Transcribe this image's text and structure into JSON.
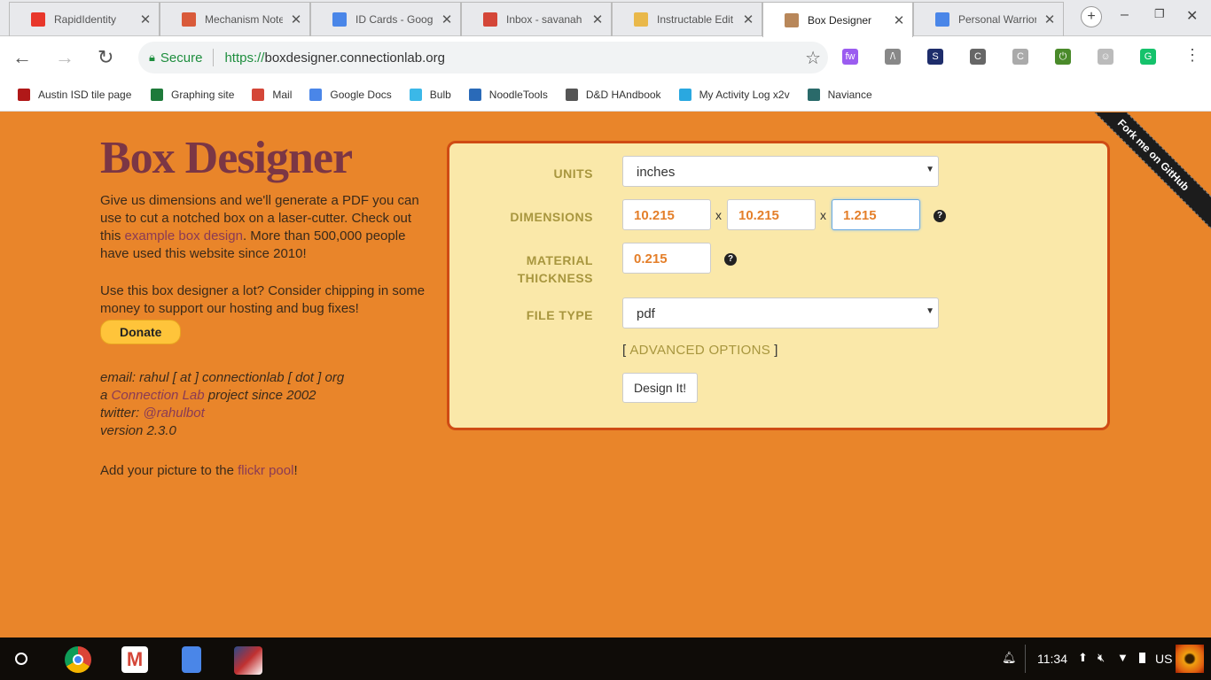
{
  "browser": {
    "tabs": [
      {
        "title": "RapidIdentity",
        "color": "#e8372b"
      },
      {
        "title": "Mechanism Note",
        "color": "#d95a3a"
      },
      {
        "title": "ID Cards - Google",
        "color": "#4a86e8"
      },
      {
        "title": "Inbox - savanah",
        "color": "#d44638"
      },
      {
        "title": "Instructable Edit",
        "color": "#e9b84a"
      },
      {
        "title": "Box Designer",
        "color": "#b8875a",
        "active": true
      },
      {
        "title": "Personal Warrior",
        "color": "#4a86e8"
      }
    ],
    "close_glyph": "✕",
    "secure_label": "Secure",
    "url_scheme": "https://",
    "url_host": "boxdesigner.connectionlab.org",
    "extensions": [
      {
        "icon": "fw-extension-icon",
        "text": "fw",
        "color": "#9b5cf0"
      },
      {
        "icon": "lambda-extension-icon",
        "text": "/\\",
        "color": "#888"
      },
      {
        "icon": "s-extension-icon",
        "text": "S",
        "color": "#1e2d6b"
      },
      {
        "icon": "c-extension-icon",
        "text": "C",
        "color": "#666"
      },
      {
        "icon": "c-gray-extension-icon",
        "text": "C",
        "color": "#aaa"
      },
      {
        "icon": "power-extension-icon",
        "text": "⏻",
        "color": "#4a8a2a"
      },
      {
        "icon": "person-extension-icon",
        "text": "☺",
        "color": "#bbb"
      },
      {
        "icon": "grammarly-icon",
        "text": "G",
        "color": "#15c26b"
      }
    ],
    "bookmarks": [
      {
        "label": "Austin ISD tile page",
        "color": "#b01818"
      },
      {
        "label": "Graphing site",
        "color": "#1e7a3a"
      },
      {
        "label": "Mail",
        "color": "#d44638"
      },
      {
        "label": "Google Docs",
        "color": "#4a86e8"
      },
      {
        "label": "Bulb",
        "color": "#3bb8e8"
      },
      {
        "label": "NoodleTools",
        "color": "#2a6ab8"
      },
      {
        "label": "D&D HAndbook",
        "color": "#555"
      },
      {
        "label": "My Activity Log x2v",
        "color": "#2aa8e0"
      },
      {
        "label": "Naviance",
        "color": "#2a6a6a"
      }
    ]
  },
  "page": {
    "title": "Box Designer",
    "intro_1": "Give us dimensions and we'll generate a PDF you can use to cut a notched box on a laser-cutter. Check out this ",
    "intro_link": "example box design",
    "intro_2": ". More than 500,000 people have used this website since 2010!",
    "donate_text": "Use this box designer a lot? Consider chipping in some money to support our hosting and bug fixes!",
    "donate_button": "Donate",
    "email": "email: rahul [ at ] connectionlab [ dot ] org",
    "project_pre": "a ",
    "project_link": "Connection Lab",
    "project_post": " project since 2002",
    "twitter_pre": "twitter: ",
    "twitter_link": "@rahulbot",
    "version": "version 2.3.0",
    "flickr_pre": "Add your picture to the ",
    "flickr_link": "flickr pool",
    "flickr_post": "!",
    "ribbon": "Fork me on GitHub"
  },
  "form": {
    "units_label": "UNITS",
    "units_value": "inches",
    "dimensions_label": "DIMENSIONS",
    "width": "10.215",
    "height": "10.215",
    "depth": "1.215",
    "times": "x",
    "thickness_label": "MATERIAL THICKNESS",
    "thickness": "0.215",
    "filetype_label": "FILE TYPE",
    "filetype_value": "pdf",
    "advanced_open": "[",
    "advanced_label": "ADVANCED OPTIONS",
    "advanced_close": "]",
    "submit": "Design It!",
    "help_glyph": "?"
  },
  "shelf": {
    "time": "11:34",
    "ime": "US"
  }
}
